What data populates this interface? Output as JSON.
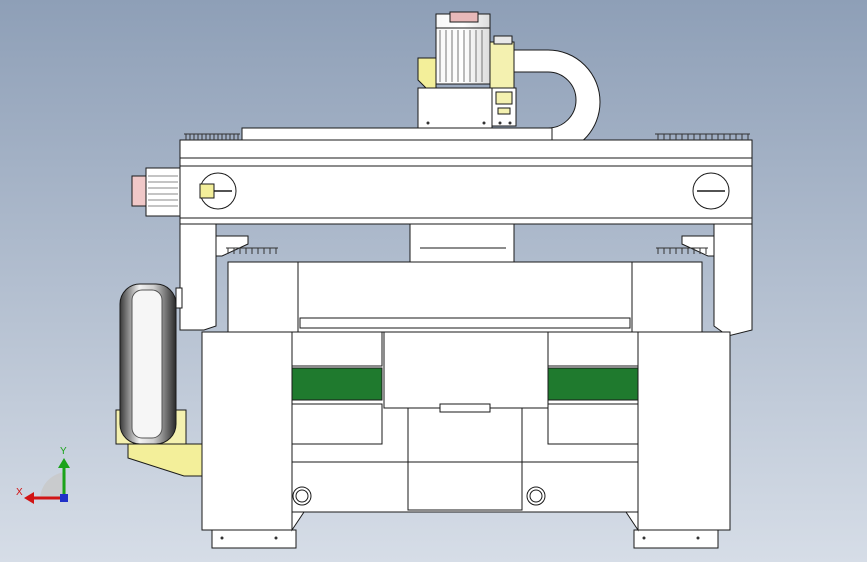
{
  "view": {
    "background_top": "#8e9fb7",
    "background_bottom": "#d6dde7",
    "part_fill": "#ffffff",
    "edge_color": "#1a1a1a",
    "accent_green": "#1f7a2e",
    "accent_yellow": "#f3ef9a",
    "accent_red": "#d98c8c"
  },
  "triad": {
    "x_label": "X",
    "y_label": "Y",
    "x_color": "#d11414",
    "y_color": "#1aa31a",
    "z_color": "#2030c8"
  }
}
